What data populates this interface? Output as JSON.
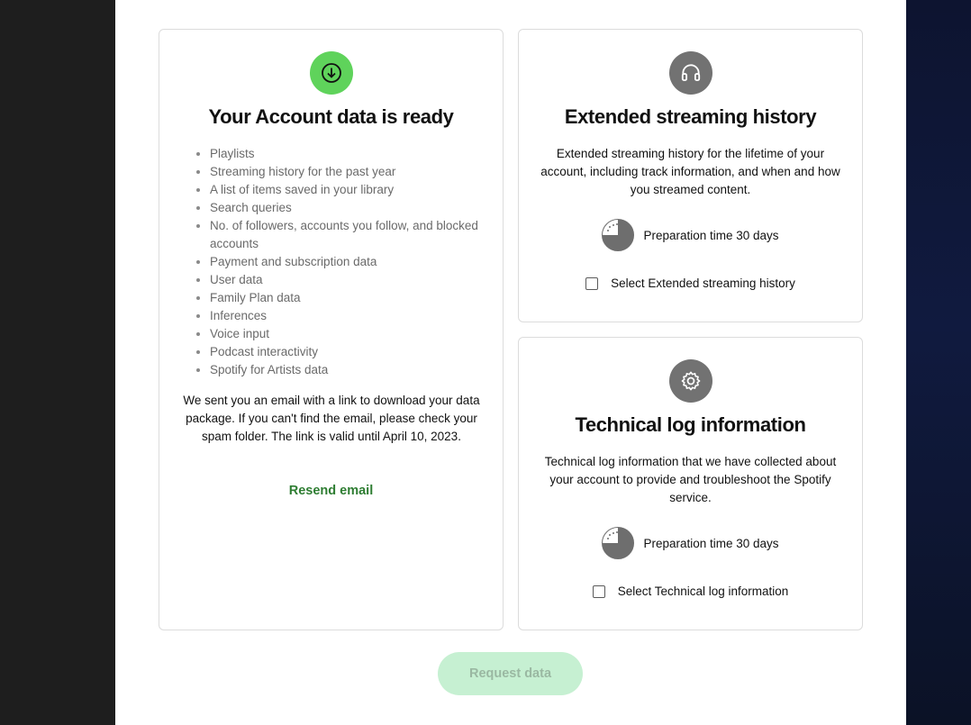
{
  "account": {
    "title": "Your Account data is ready",
    "items": [
      "Playlists",
      "Streaming history for the past year",
      "A list of items saved in your library",
      "Search queries",
      "No. of followers, accounts you follow, and blocked accounts",
      "Payment and subscription data",
      "User data",
      "Family Plan data",
      "Inferences",
      "Voice input",
      "Podcast interactivity",
      "Spotify for Artists data"
    ],
    "email_note": "We sent you an email with a link to download your data package. If you can't find the email, please check your spam folder. The link is valid until April 10, 2023.",
    "resend_label": "Resend email",
    "icon": "download-arrow-icon",
    "icon_color": "#5fd35b"
  },
  "extended": {
    "title": "Extended streaming history",
    "description": "Extended streaming history for the lifetime of your account, including track information, and when and how you streamed content.",
    "prep_text": "Preparation time 30 days",
    "select_label": "Select Extended streaming history",
    "checked": false,
    "icon": "headphones-icon"
  },
  "technical": {
    "title": "Technical log information",
    "description": "Technical log information that we have collected about your account to provide and troubleshoot the Spotify service.",
    "prep_text": "Preparation time 30 days",
    "select_label": "Select Technical log information",
    "checked": false,
    "icon": "gear-icon"
  },
  "request_button": {
    "label": "Request data",
    "enabled": false,
    "bg_color": "#c6f0d2"
  }
}
